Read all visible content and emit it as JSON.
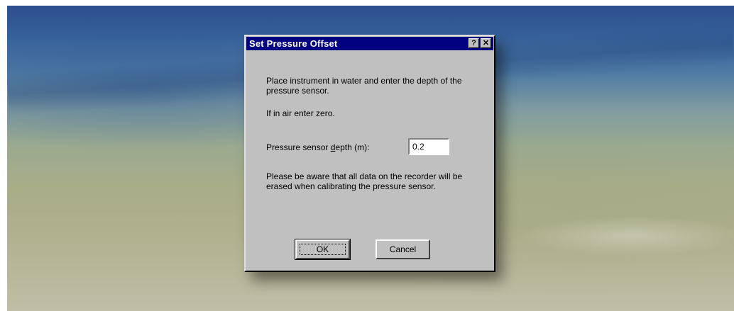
{
  "dialog": {
    "title": "Set Pressure Offset",
    "help_glyph": "?",
    "close_glyph": "✕",
    "instruction_1": "Place instrument in water and enter the depth of the pressure sensor.",
    "instruction_2": "If in air enter zero.",
    "depth_label_prefix": "Pressure sensor ",
    "depth_label_mnemonic": "d",
    "depth_label_suffix": "epth (m):",
    "depth_value": "0.2",
    "warning": "Please be aware that all data on the recorder will be erased when calibrating the pressure sensor.",
    "ok_label": "OK",
    "cancel_label": "Cancel"
  },
  "icons": {
    "help": "help-icon",
    "close": "close-icon"
  },
  "colors": {
    "titlebar": "#000080",
    "dialog_face": "#c0c0c0"
  }
}
